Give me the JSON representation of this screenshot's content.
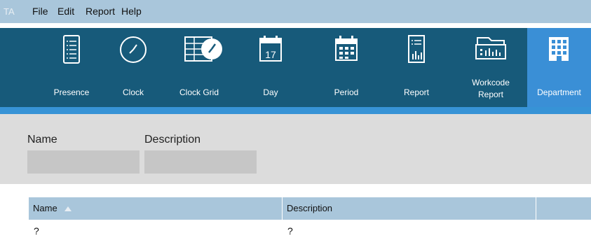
{
  "app": {
    "badge": "TA"
  },
  "menu": [
    "File",
    "Edit",
    "Report",
    "Help"
  ],
  "toolbar": {
    "items": [
      {
        "label": "Presence",
        "icon": "checklist-icon"
      },
      {
        "label": "Clock",
        "icon": "clock-icon"
      },
      {
        "label": "Clock Grid",
        "icon": "clock-grid-icon"
      },
      {
        "label": "Day",
        "icon": "calendar-day-icon",
        "day_number": "17"
      },
      {
        "label": "Period",
        "icon": "calendar-period-icon"
      },
      {
        "label": "Report",
        "icon": "report-icon"
      },
      {
        "label_lines": [
          "Workcode",
          "Report"
        ],
        "icon": "workcode-folder-icon"
      },
      {
        "label": "Department",
        "icon": "building-icon",
        "active": true
      }
    ]
  },
  "filter": {
    "name_label": "Name",
    "name_value": "",
    "description_label": "Description",
    "description_value": ""
  },
  "table": {
    "columns": [
      "Name",
      "Description",
      ""
    ],
    "sort_column": "Name",
    "sort_direction": "ascending",
    "rows": [
      {
        "name": "?",
        "description": "?"
      }
    ]
  },
  "colors": {
    "menubar": "#a9c6db",
    "toolbar": "#175a7a",
    "toolbar_active": "#3a8fd6",
    "toolbar_stripe": "#3793d6",
    "filter_panel": "#dcdcdc",
    "input_fill": "#c6c6c6",
    "table_header": "#a9c6db"
  }
}
